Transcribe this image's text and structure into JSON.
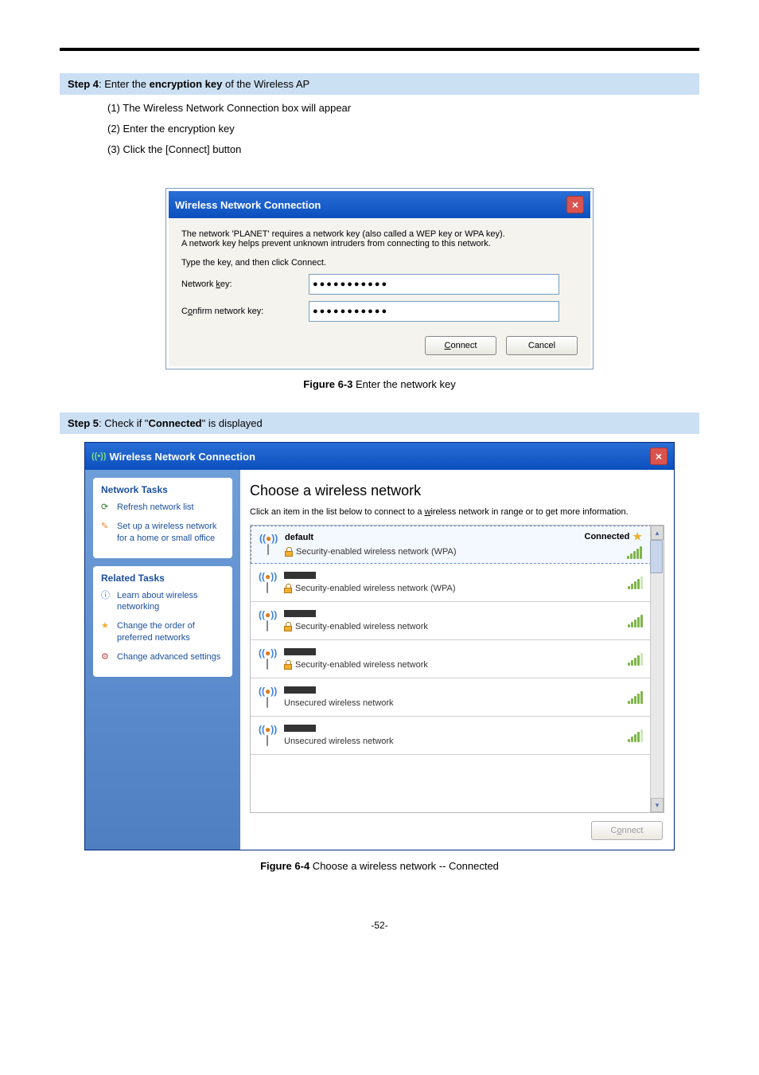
{
  "step4": {
    "title_prefix": "Step 4",
    "title_rest1": ": Enter the ",
    "title_bold": "encryption key",
    "title_rest2": " of the Wireless AP",
    "items": [
      "(1)  The Wireless Network Connection box will appear",
      "(2)  Enter the encryption key",
      "(3)  Click the [Connect] button"
    ]
  },
  "dialog1": {
    "title": "Wireless Network Connection",
    "desc1": "The network 'PLANET' requires a network key (also called a WEP key or WPA key).",
    "desc2": "A network key helps prevent unknown intruders from connecting to this network.",
    "desc3": "Type the key, and then click Connect.",
    "label1_pre": "Network ",
    "label1_u": "k",
    "label1_post": "ey:",
    "label2_pre": "C",
    "label2_u": "o",
    "label2_post": "nfirm network key:",
    "value1": "●●●●●●●●●●●",
    "value2": "●●●●●●●●●●●",
    "btn_connect": "Connect",
    "btn_cancel": "Cancel"
  },
  "fig1_bold": "Figure 6-3",
  "fig1_rest": " Enter the network key",
  "step5": {
    "title_prefix": "Step 5",
    "title_rest1": ": Check if \"",
    "title_bold": "Connected",
    "title_rest2": "\" is displayed"
  },
  "dialog2": {
    "title": "Wireless Network Connection",
    "side1_head": "Network Tasks",
    "side1_links": [
      "Refresh network list",
      "Set up a wireless network for a home or small office"
    ],
    "side2_head": "Related Tasks",
    "side2_links": [
      "Learn about wireless networking",
      "Change the order of preferred networks",
      "Change advanced settings"
    ],
    "heading": "Choose a wireless network",
    "desc_pre": "Click an item in the list below to connect to a ",
    "desc_u": "w",
    "desc_post": "ireless network in range or to get more information.",
    "networks": [
      {
        "name": "default",
        "sec": "Security-enabled wireless network (WPA)",
        "connected": true,
        "locked": true,
        "sig": "full"
      },
      {
        "name": "",
        "sec": "Security-enabled wireless network (WPA)",
        "connected": false,
        "locked": true,
        "sig": "s4"
      },
      {
        "name": "",
        "sec": "Security-enabled wireless network",
        "connected": false,
        "locked": true,
        "sig": "full"
      },
      {
        "name": "",
        "sec": "Security-enabled wireless network",
        "connected": false,
        "locked": true,
        "sig": "s4"
      },
      {
        "name": "",
        "sec": "Unsecured wireless network",
        "connected": false,
        "locked": false,
        "sig": "full"
      },
      {
        "name": "",
        "sec": "Unsecured wireless network",
        "connected": false,
        "locked": false,
        "sig": "s4"
      }
    ],
    "connected_label": "Connected",
    "connect_btn_pre": "C",
    "connect_btn_u": "o",
    "connect_btn_post": "nnect"
  },
  "fig2_bold": "Figure 6-4",
  "fig2_rest": " Choose a wireless network -- Connected",
  "page_number": "-52-"
}
